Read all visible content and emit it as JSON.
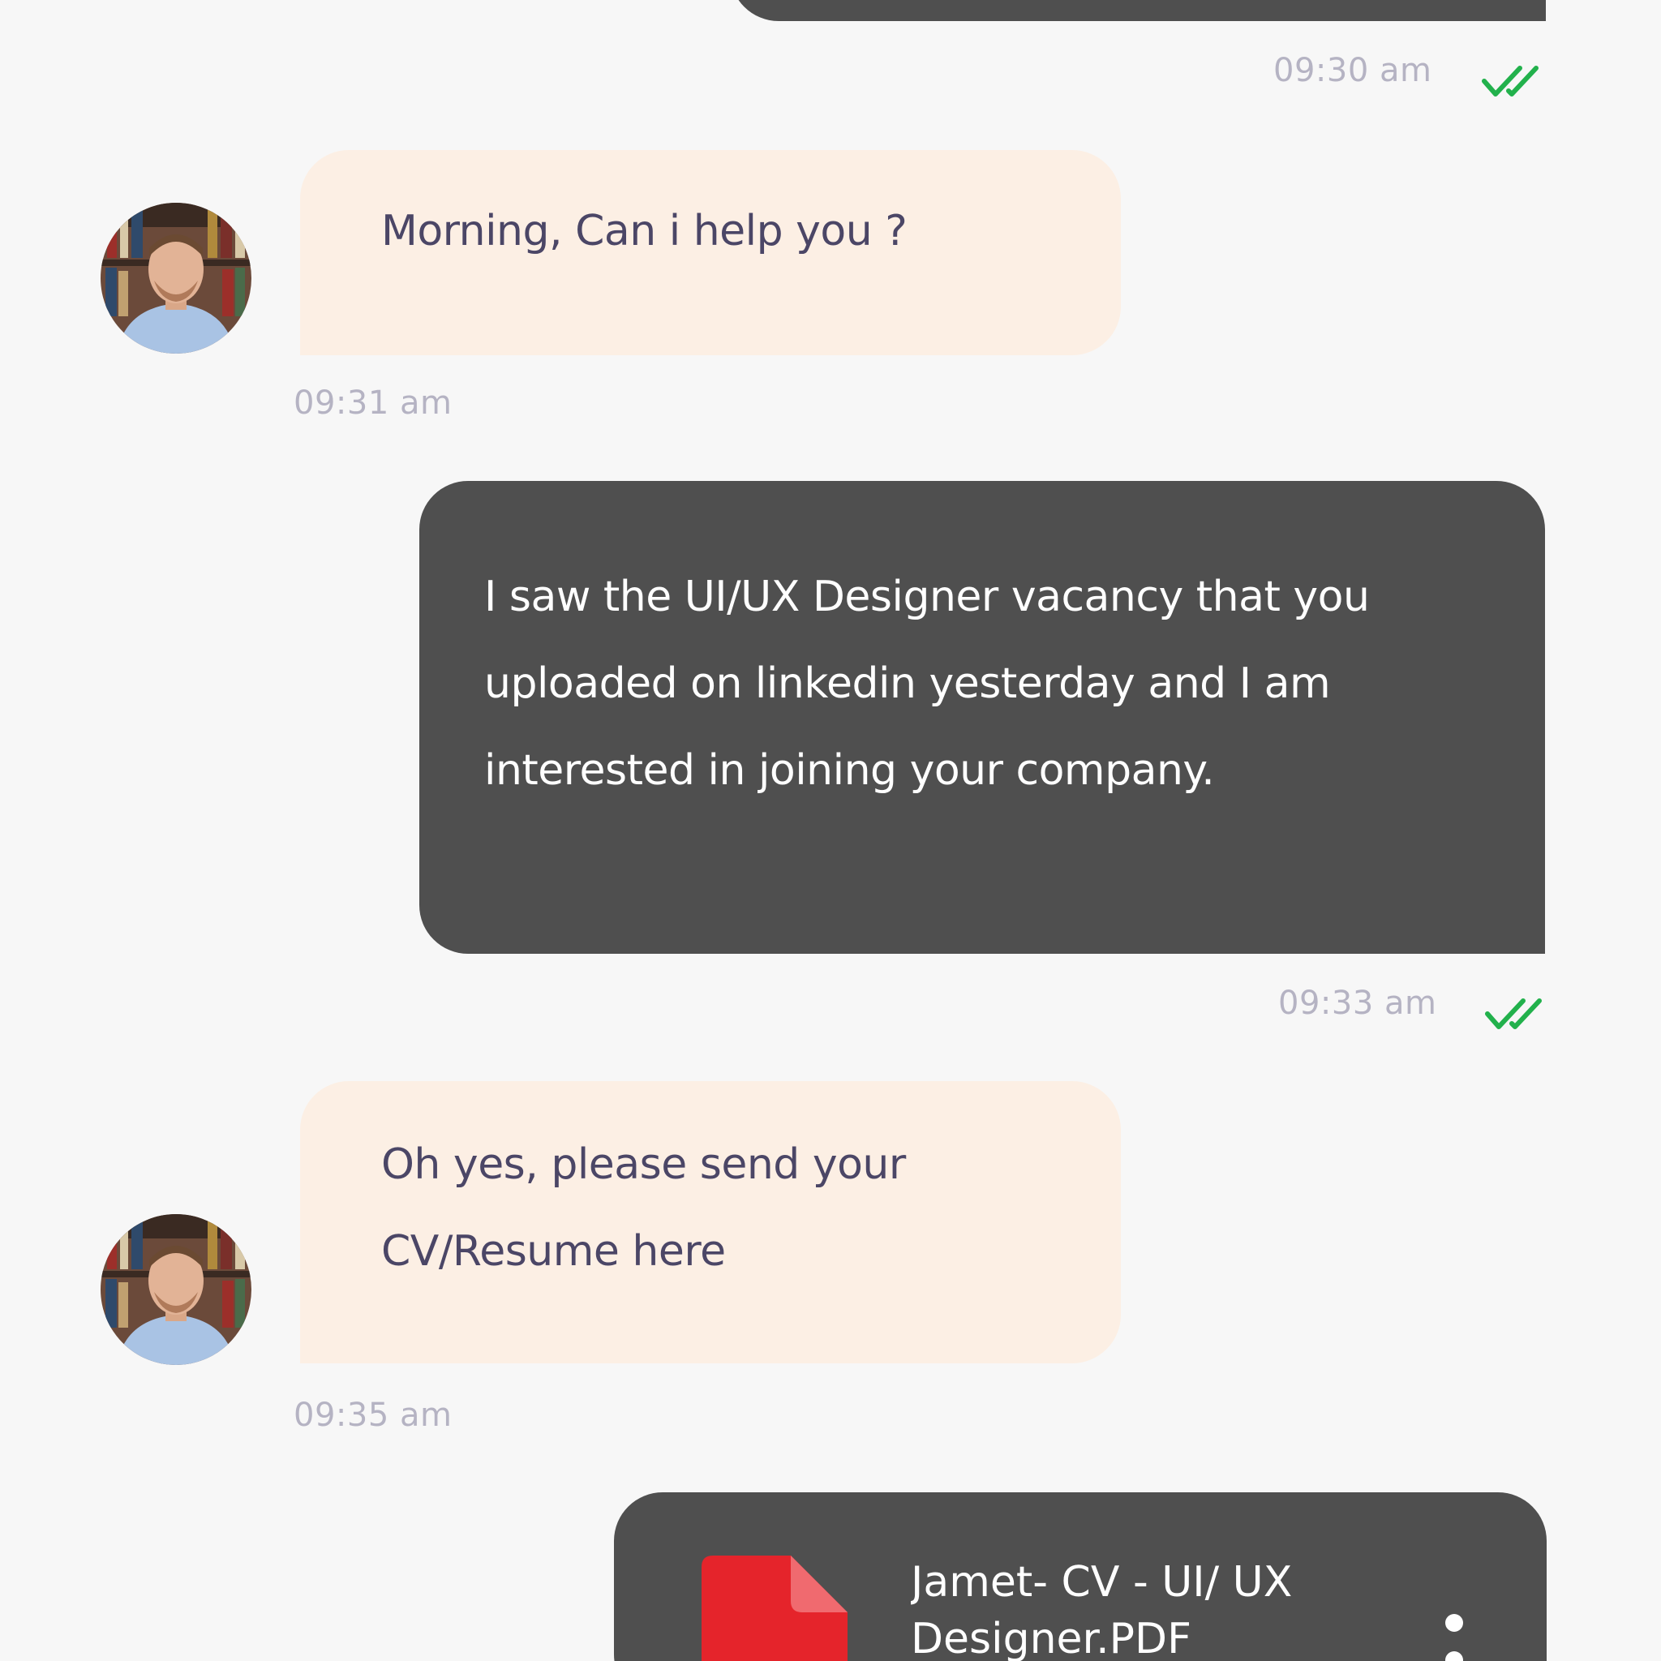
{
  "colors": {
    "background": "#f7f7f7",
    "outgoing_bubble": "#4f4f4f",
    "incoming_bubble": "#fcefe4",
    "incoming_text": "#4b4666",
    "timestamp": "#b5b3c3",
    "read_check": "#22b14c",
    "file_icon": "#e5242b"
  },
  "messages": [
    {
      "direction": "outgoing",
      "time": "09:30 am",
      "status": "read"
    },
    {
      "direction": "incoming",
      "text": "Morning, Can i help you ?",
      "time": "09:31 am",
      "avatar": "avatar"
    },
    {
      "direction": "outgoing",
      "text": "I saw the UI/UX Designer vacancy that you uploaded on linkedin yesterday and I am interested in joining your company.",
      "time": "09:33 am",
      "status": "read"
    },
    {
      "direction": "incoming",
      "text": "Oh yes, please send your CV/Resume here",
      "time": "09:35 am",
      "avatar": "avatar"
    },
    {
      "direction": "outgoing",
      "type": "file",
      "file_name": "Jamet- CV - UI/ UX Designer.PDF",
      "file_icon": "pdf-file-icon",
      "menu_icon": "more-vertical-icon"
    }
  ]
}
